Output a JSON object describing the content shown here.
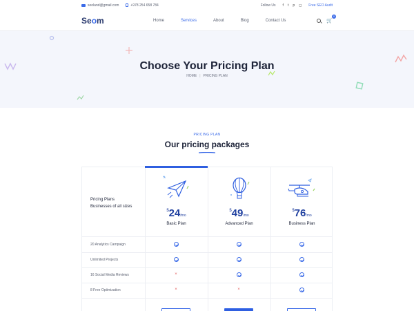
{
  "topbar": {
    "email": "seoland@gmail.com",
    "phone": "+978 254 658 784",
    "follow_label": "Follow Us",
    "social_icons": [
      "facebook-icon",
      "twitter-icon",
      "pinterest-icon",
      "instagram-icon"
    ],
    "audit_link": "Free SEO Audit"
  },
  "nav": {
    "logo": {
      "before": "Se",
      "highlight": "o",
      "after": "m"
    },
    "items": [
      {
        "label": "Home",
        "active": false
      },
      {
        "label": "Services",
        "active": true
      },
      {
        "label": "About",
        "active": false
      },
      {
        "label": "Blog",
        "active": false
      },
      {
        "label": "Contact Us",
        "active": false
      }
    ],
    "cart_count": "0"
  },
  "hero": {
    "title": "Choose Your Pricing Plan",
    "breadcrumb_home": "HOME",
    "breadcrumb_sep": "|",
    "breadcrumb_current": "PRICING PLAN"
  },
  "section": {
    "kicker": "PRICING PLAN",
    "title": "Our pricing packages"
  },
  "table": {
    "label_line1": "Pricing Plans",
    "label_line2": "Businesses of all sizes",
    "plans": [
      {
        "currency": "$",
        "amount": "24",
        "period": "/mo",
        "name": "Basic Plan",
        "icon": "paper-plane-icon",
        "featured": true
      },
      {
        "currency": "$",
        "amount": "49",
        "period": "/mo",
        "name": "Advanced Plan",
        "icon": "hot-air-balloon-icon",
        "featured": false
      },
      {
        "currency": "$",
        "amount": "76",
        "period": "/mo",
        "name": "Business Plan",
        "icon": "helicopter-icon",
        "featured": false
      }
    ],
    "features": [
      {
        "label": "20 Analytics Campaign",
        "marks": [
          "check",
          "check",
          "check"
        ]
      },
      {
        "label": "Unlimited Projects",
        "marks": [
          "check",
          "check",
          "check"
        ]
      },
      {
        "label": "16 Social Media Reviews",
        "marks": [
          "cross",
          "check",
          "check"
        ]
      },
      {
        "label": "8 Free Optimization",
        "marks": [
          "cross",
          "cross",
          "check"
        ]
      }
    ]
  },
  "colors": {
    "accent": "#3b6be8",
    "heading": "#1d2338",
    "hero_bg": "#f4f6fc",
    "cross": "#e25b5b"
  }
}
